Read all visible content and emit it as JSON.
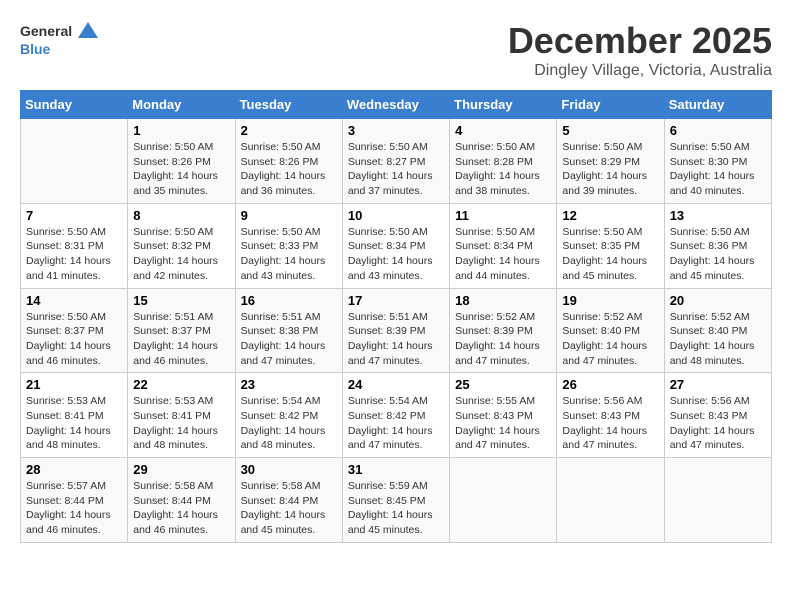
{
  "header": {
    "logo_general": "General",
    "logo_blue": "Blue",
    "month": "December 2025",
    "location": "Dingley Village, Victoria, Australia"
  },
  "days_of_week": [
    "Sunday",
    "Monday",
    "Tuesday",
    "Wednesday",
    "Thursday",
    "Friday",
    "Saturday"
  ],
  "weeks": [
    [
      {
        "day": "",
        "info": ""
      },
      {
        "day": "1",
        "info": "Sunrise: 5:50 AM\nSunset: 8:26 PM\nDaylight: 14 hours\nand 35 minutes."
      },
      {
        "day": "2",
        "info": "Sunrise: 5:50 AM\nSunset: 8:26 PM\nDaylight: 14 hours\nand 36 minutes."
      },
      {
        "day": "3",
        "info": "Sunrise: 5:50 AM\nSunset: 8:27 PM\nDaylight: 14 hours\nand 37 minutes."
      },
      {
        "day": "4",
        "info": "Sunrise: 5:50 AM\nSunset: 8:28 PM\nDaylight: 14 hours\nand 38 minutes."
      },
      {
        "day": "5",
        "info": "Sunrise: 5:50 AM\nSunset: 8:29 PM\nDaylight: 14 hours\nand 39 minutes."
      },
      {
        "day": "6",
        "info": "Sunrise: 5:50 AM\nSunset: 8:30 PM\nDaylight: 14 hours\nand 40 minutes."
      }
    ],
    [
      {
        "day": "7",
        "info": "Sunrise: 5:50 AM\nSunset: 8:31 PM\nDaylight: 14 hours\nand 41 minutes."
      },
      {
        "day": "8",
        "info": "Sunrise: 5:50 AM\nSunset: 8:32 PM\nDaylight: 14 hours\nand 42 minutes."
      },
      {
        "day": "9",
        "info": "Sunrise: 5:50 AM\nSunset: 8:33 PM\nDaylight: 14 hours\nand 43 minutes."
      },
      {
        "day": "10",
        "info": "Sunrise: 5:50 AM\nSunset: 8:34 PM\nDaylight: 14 hours\nand 43 minutes."
      },
      {
        "day": "11",
        "info": "Sunrise: 5:50 AM\nSunset: 8:34 PM\nDaylight: 14 hours\nand 44 minutes."
      },
      {
        "day": "12",
        "info": "Sunrise: 5:50 AM\nSunset: 8:35 PM\nDaylight: 14 hours\nand 45 minutes."
      },
      {
        "day": "13",
        "info": "Sunrise: 5:50 AM\nSunset: 8:36 PM\nDaylight: 14 hours\nand 45 minutes."
      }
    ],
    [
      {
        "day": "14",
        "info": "Sunrise: 5:50 AM\nSunset: 8:37 PM\nDaylight: 14 hours\nand 46 minutes."
      },
      {
        "day": "15",
        "info": "Sunrise: 5:51 AM\nSunset: 8:37 PM\nDaylight: 14 hours\nand 46 minutes."
      },
      {
        "day": "16",
        "info": "Sunrise: 5:51 AM\nSunset: 8:38 PM\nDaylight: 14 hours\nand 47 minutes."
      },
      {
        "day": "17",
        "info": "Sunrise: 5:51 AM\nSunset: 8:39 PM\nDaylight: 14 hours\nand 47 minutes."
      },
      {
        "day": "18",
        "info": "Sunrise: 5:52 AM\nSunset: 8:39 PM\nDaylight: 14 hours\nand 47 minutes."
      },
      {
        "day": "19",
        "info": "Sunrise: 5:52 AM\nSunset: 8:40 PM\nDaylight: 14 hours\nand 47 minutes."
      },
      {
        "day": "20",
        "info": "Sunrise: 5:52 AM\nSunset: 8:40 PM\nDaylight: 14 hours\nand 48 minutes."
      }
    ],
    [
      {
        "day": "21",
        "info": "Sunrise: 5:53 AM\nSunset: 8:41 PM\nDaylight: 14 hours\nand 48 minutes."
      },
      {
        "day": "22",
        "info": "Sunrise: 5:53 AM\nSunset: 8:41 PM\nDaylight: 14 hours\nand 48 minutes."
      },
      {
        "day": "23",
        "info": "Sunrise: 5:54 AM\nSunset: 8:42 PM\nDaylight: 14 hours\nand 48 minutes."
      },
      {
        "day": "24",
        "info": "Sunrise: 5:54 AM\nSunset: 8:42 PM\nDaylight: 14 hours\nand 47 minutes."
      },
      {
        "day": "25",
        "info": "Sunrise: 5:55 AM\nSunset: 8:43 PM\nDaylight: 14 hours\nand 47 minutes."
      },
      {
        "day": "26",
        "info": "Sunrise: 5:56 AM\nSunset: 8:43 PM\nDaylight: 14 hours\nand 47 minutes."
      },
      {
        "day": "27",
        "info": "Sunrise: 5:56 AM\nSunset: 8:43 PM\nDaylight: 14 hours\nand 47 minutes."
      }
    ],
    [
      {
        "day": "28",
        "info": "Sunrise: 5:57 AM\nSunset: 8:44 PM\nDaylight: 14 hours\nand 46 minutes."
      },
      {
        "day": "29",
        "info": "Sunrise: 5:58 AM\nSunset: 8:44 PM\nDaylight: 14 hours\nand 46 minutes."
      },
      {
        "day": "30",
        "info": "Sunrise: 5:58 AM\nSunset: 8:44 PM\nDaylight: 14 hours\nand 45 minutes."
      },
      {
        "day": "31",
        "info": "Sunrise: 5:59 AM\nSunset: 8:45 PM\nDaylight: 14 hours\nand 45 minutes."
      },
      {
        "day": "",
        "info": ""
      },
      {
        "day": "",
        "info": ""
      },
      {
        "day": "",
        "info": ""
      }
    ]
  ]
}
